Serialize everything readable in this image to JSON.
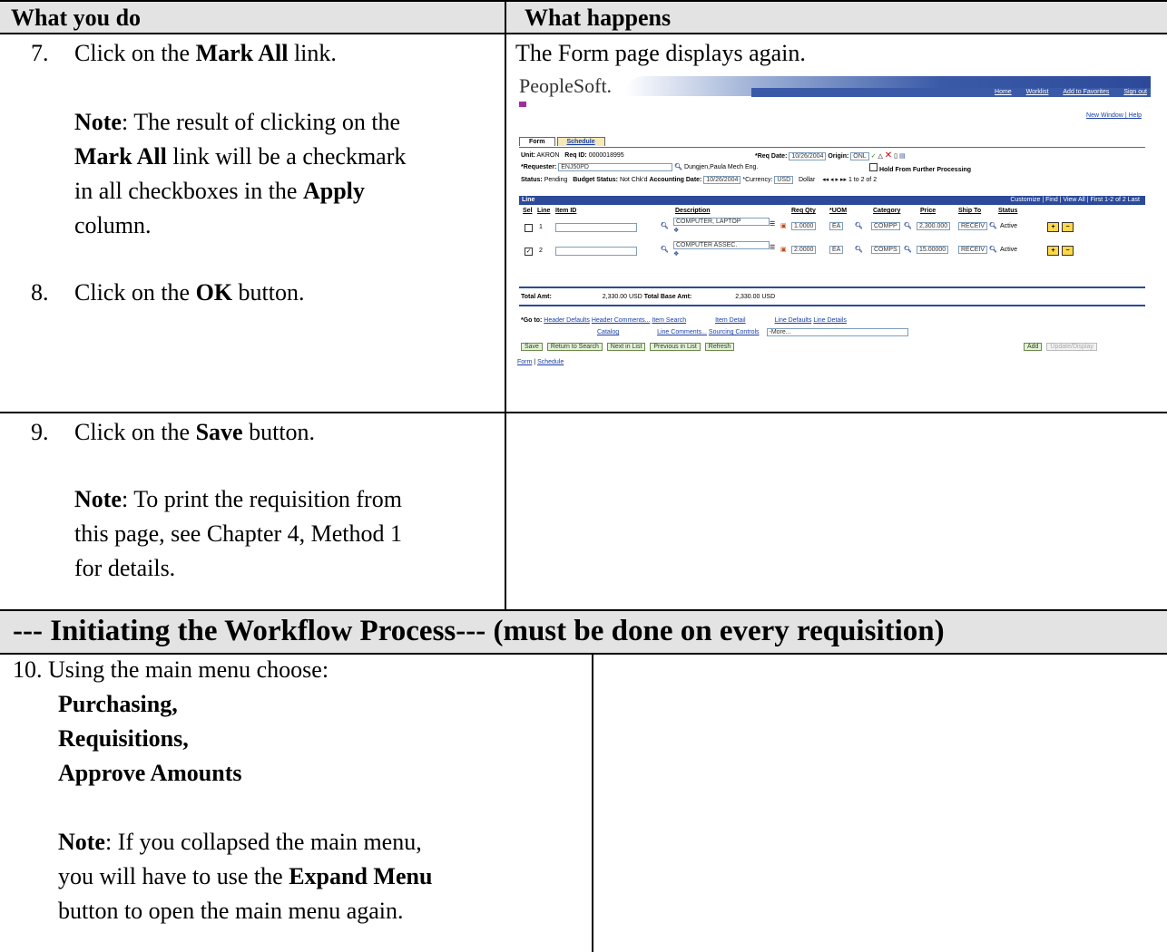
{
  "table": {
    "col_left_header": "What you do",
    "col_right_header": "What happens"
  },
  "steps": {
    "s7": {
      "num": "7.",
      "text_before": "Click on the ",
      "bold": "Mark All",
      "text_after": " link."
    },
    "s7_note": {
      "label": "Note",
      "line1_rest": ":  The result of clicking on the",
      "line2_bold": "Mark All",
      "line2_rest": " link will be a checkmark",
      "line3": "in all checkboxes in the ",
      "line3_bold": "Apply",
      "line4": "column."
    },
    "s7_result": "The Form page displays again.",
    "s8": {
      "num": "8.",
      "text_before": "Click on the ",
      "bold": "OK",
      "text_after": " button."
    },
    "s9": {
      "num": "9.",
      "text_before": "Click on the ",
      "bold": "Save",
      "text_after": " button."
    },
    "s9_note": {
      "label": "Note",
      "line1_rest": ":  To print the requisition from",
      "line2": "this page, see Chapter 4, Method 1",
      "line3": "for details."
    }
  },
  "section": {
    "title": "--- Initiating the Workflow Process--- (must be done on every requisition)"
  },
  "step10": {
    "num": "10.",
    "intro": "Using the main menu choose:",
    "menu1": "Purchasing,",
    "menu2": "Requisitions,",
    "menu3": "Approve Amounts",
    "note_label": "Note",
    "note_line1_rest": ":  If you collapsed the main menu,",
    "note_line2_before": "you will have to use the ",
    "note_line2_bold": "Expand Menu",
    "note_line3": "button to open the main menu again."
  },
  "peoplesoft": {
    "logo": "PeopleSoft.",
    "top_links": [
      "Home",
      "Worklist",
      "Add to Favorites",
      "Sign out"
    ],
    "new_window": "New Window",
    "help": "Help",
    "tabs": [
      "Form",
      "Schedule"
    ],
    "unit_label": "Unit:",
    "unit_value": "AKRON",
    "reqid_label": "Req ID:",
    "reqid_value": "0000018995",
    "reqdate_label": "*Req Date:",
    "reqdate_value": "10/26/2004",
    "origin_label": "Origin:",
    "origin_value": "ONL",
    "requester_label": "*Requester:",
    "requester_value": "ENJ50PD",
    "requester_name": "Dungjen,Paula Mech Eng.",
    "hold_label": "Hold From Further Processing",
    "status_label": "Status:",
    "status_value": "Pending",
    "budget_label": "Budget Status:",
    "budget_value": "Not Chk'd",
    "acctdate_label": "Accounting Date:",
    "acctdate_value": "10/26/2004",
    "currency_label": "*Currency:",
    "currency_value": "USD",
    "currency_name": "Dollar",
    "paging": "1 to 2 of 2",
    "grid_title": "Line",
    "grid_nav": "Customize | Find | View All |     First  1-2 of 2  Last",
    "columns": [
      "Sel",
      "Line",
      "Item ID",
      "Description",
      "Req Qty",
      "*UOM",
      "Category",
      "Price",
      "Ship To",
      "Status"
    ],
    "rows": [
      {
        "sel": "",
        "line": "1",
        "desc": "COMPUTER, LAPTOP",
        "qty": "1.0000",
        "uom": "EA",
        "cat": "COMPP",
        "price": "2,300.000",
        "ship": "RECEIV",
        "status": "Active"
      },
      {
        "sel": "✓",
        "line": "2",
        "desc": "COMPUTER ASSEC.",
        "qty": "2.0000",
        "uom": "EA",
        "cat": "COMPS",
        "price": "15.00000",
        "ship": "RECEIV",
        "status": "Active"
      }
    ],
    "total_label": "Total Amt:",
    "total_value": "2,330.00  USD",
    "total_base_label": "Total Base Amt:",
    "total_base_value": "2,330.00  USD",
    "goto_label": "*Go to:",
    "goto_links_row1": [
      "Header Defaults",
      "Header Comments...",
      "Item Search",
      "Item Detail",
      "Line Defaults",
      "Line Details"
    ],
    "goto_links_row2": [
      "Catalog",
      "Line Comments...",
      "Sourcing Controls"
    ],
    "more_select": "-More...",
    "buttons": [
      "Save",
      "Return to Search",
      "Next in List",
      "Previous in List",
      "Refresh"
    ],
    "add_button": "Add",
    "update_button": "Update/Display",
    "footer_links": [
      "Form",
      "Schedule"
    ]
  },
  "colors": {
    "header_bg": "#e3e3e3",
    "ps_blue": "#2c4a99"
  }
}
